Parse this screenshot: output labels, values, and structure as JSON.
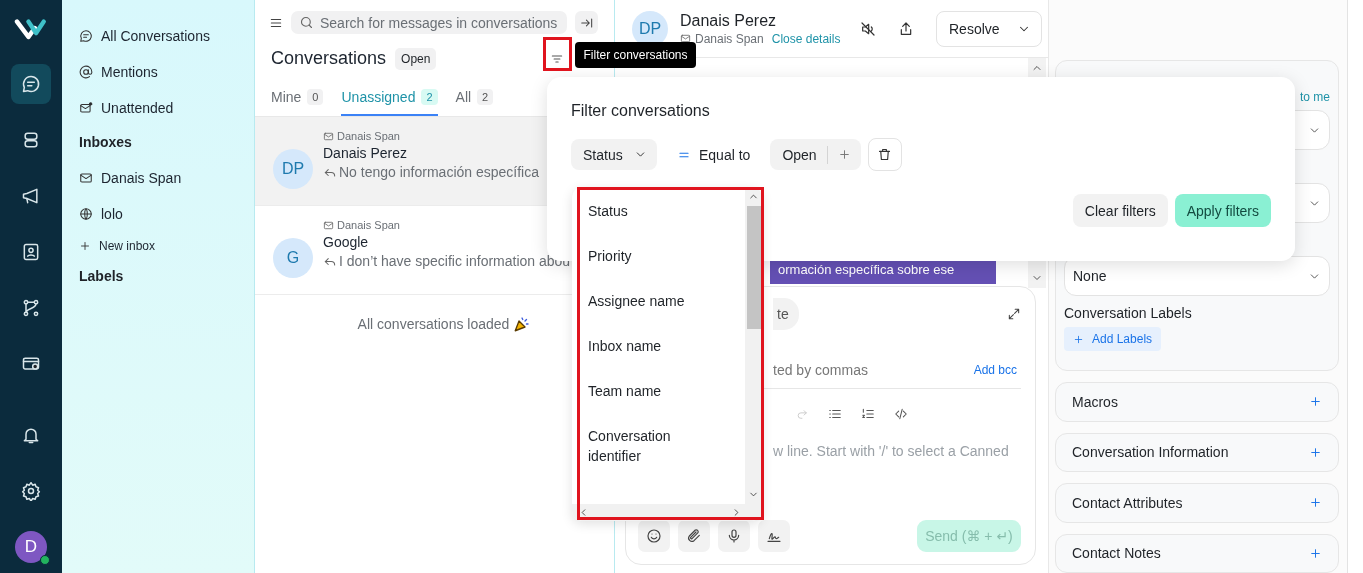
{
  "rail": {
    "items": [
      {
        "kind": "chat",
        "selected": true
      },
      {
        "kind": "bot",
        "selected": false
      },
      {
        "kind": "megaphone",
        "selected": false
      },
      {
        "kind": "contacts",
        "selected": false
      },
      {
        "kind": "flow",
        "selected": false
      },
      {
        "kind": "billing",
        "selected": false
      }
    ],
    "bottom": [
      {
        "kind": "bell"
      },
      {
        "kind": "gear"
      }
    ],
    "avatar": {
      "initial": "D",
      "online": true
    }
  },
  "sidebar": {
    "items": [
      {
        "kind": "chat",
        "label": "All Conversations"
      },
      {
        "kind": "at",
        "label": "Mentions"
      },
      {
        "kind": "mail-dot",
        "label": "Unattended"
      }
    ],
    "inboxes_heading": "Inboxes",
    "inboxes": [
      {
        "kind": "mail",
        "label": "Danais Span"
      },
      {
        "kind": "globe",
        "label": "lolo"
      }
    ],
    "new_inbox": "New inbox",
    "labels_heading": "Labels"
  },
  "conversation_list": {
    "search": {
      "placeholder": "Search for messages in conversations"
    },
    "title": "Conversations",
    "status_badge": "Open",
    "filter_button": {
      "highlighted": true
    },
    "tabs": [
      {
        "label": "Mine",
        "count": "0",
        "selected": false
      },
      {
        "label": "Unassigned",
        "count": "2",
        "selected": true
      },
      {
        "label": "All",
        "count": "2",
        "selected": false
      }
    ],
    "conversations": [
      {
        "inbox": "Danais Span",
        "initials": "DP",
        "name": "Danais Perez",
        "preview": "No tengo información específica",
        "selected": true
      },
      {
        "inbox": "Danais Span",
        "initials": "G",
        "name": "Google",
        "preview": "I don’t have specific information abou",
        "selected": false
      }
    ],
    "footer": "All conversations loaded"
  },
  "tooltip": "Filter conversations",
  "conversation": {
    "initials": "DP",
    "name": "Danais Perez",
    "inbox": "Danais Span",
    "close_link": "Close details",
    "resolve": "Resolve",
    "message": "ormación específica sobre ese",
    "composer": {
      "mode_tab": "te",
      "cc_placeholder": "ted by commas",
      "add_bcc": "Add bcc",
      "placeholder": "w line. Start with '/' to select a Canned",
      "send": "Send (⌘ + ↵)"
    }
  },
  "details": {
    "assign_link": "to me",
    "priority": "None",
    "labels_title": "Conversation Labels",
    "add_labels": "Add Labels",
    "sections": [
      "Macros",
      "Conversation Information",
      "Contact Attributes",
      "Contact Notes"
    ]
  },
  "filter_popup": {
    "title": "Filter conversations",
    "condition": {
      "attribute": "Status",
      "operator": "Equal to",
      "value": "Open"
    },
    "clear": "Clear filters",
    "apply": "Apply filters",
    "dropdown": {
      "highlighted": true,
      "options": [
        "Status",
        "Priority",
        "Assignee name",
        "Inbox name",
        "Team name",
        "Conversation identifier"
      ]
    }
  }
}
